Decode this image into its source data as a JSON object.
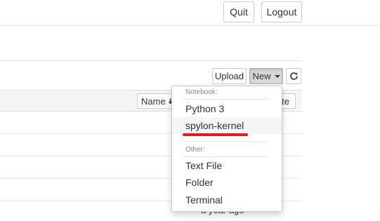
{
  "header": {
    "quit_label": "Quit",
    "logout_label": "Logout"
  },
  "toolbar": {
    "upload_label": "Upload",
    "new_label": "New",
    "refresh_icon": "refresh-icon"
  },
  "file_list": {
    "sort_name_label": "Name",
    "sort_modified_label": "te",
    "rows": [
      {
        "modified": ""
      },
      {
        "modified": ""
      },
      {
        "modified": ""
      },
      {
        "modified": ""
      },
      {
        "modified": "a year ago"
      }
    ]
  },
  "new_menu": {
    "notebook_header": "Notebook:",
    "notebook_items": [
      "Python 3",
      "spylon-kernel"
    ],
    "other_header": "Other:",
    "other_items": [
      "Text File",
      "Folder",
      "Terminal"
    ],
    "highlighted_item": "spylon-kernel",
    "annotation_color": "#e3172d"
  }
}
